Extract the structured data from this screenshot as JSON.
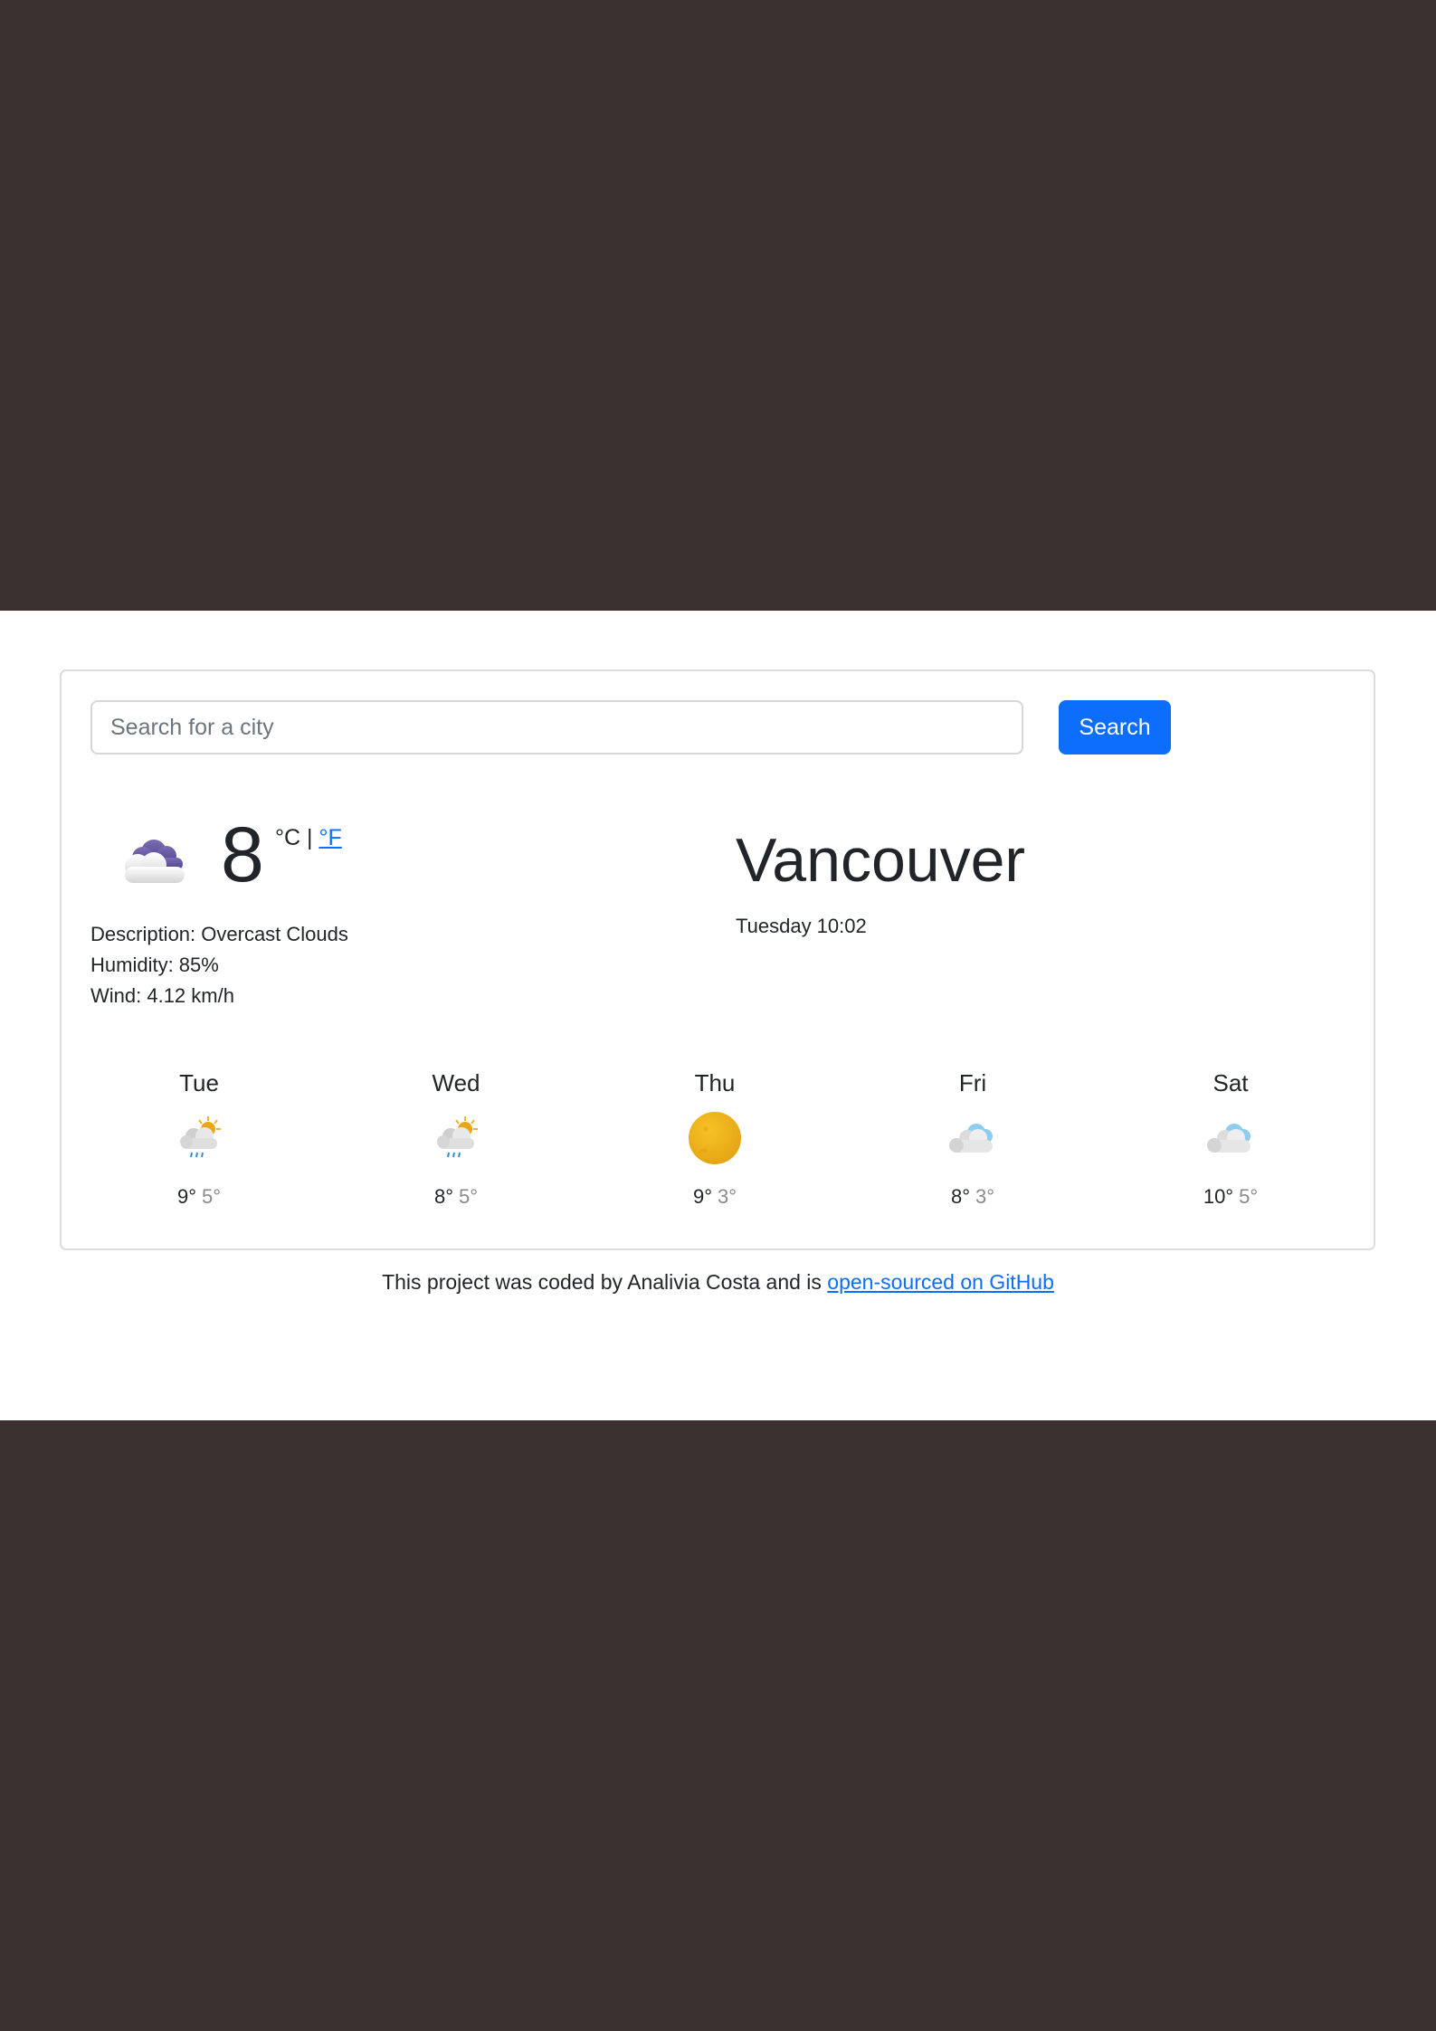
{
  "search": {
    "placeholder": "Search for a city",
    "button_label": "Search"
  },
  "current": {
    "icon": "overcast-cloud-icon",
    "temperature": "8",
    "unit_celsius": "°C",
    "unit_separator": "|",
    "unit_fahrenheit": "°F",
    "description": "Description: Overcast Clouds",
    "humidity": "Humidity: 85%",
    "wind": "Wind: 4.12 km/h"
  },
  "city": {
    "name": "Vancouver",
    "datetime": "Tuesday 10:02"
  },
  "forecast": [
    {
      "day": "Tue",
      "max": "9°",
      "min": "5°",
      "icon": "sun-rain-cloud-icon"
    },
    {
      "day": "Wed",
      "max": "8°",
      "min": "5°",
      "icon": "sun-rain-cloud-icon"
    },
    {
      "day": "Thu",
      "max": "9°",
      "min": "3°",
      "icon": "sun-icon"
    },
    {
      "day": "Fri",
      "max": "8°",
      "min": "3°",
      "icon": "blue-cloud-icon"
    },
    {
      "day": "Sat",
      "max": "10°",
      "min": "5°",
      "icon": "blue-cloud-icon"
    }
  ],
  "footer": {
    "text": "This project was coded by Analivia Costa and is ",
    "link_text": "open-sourced on GitHub"
  },
  "colors": {
    "background": "#3a3030",
    "accent": "#0d6efd",
    "muted": "#8a8a8a"
  }
}
